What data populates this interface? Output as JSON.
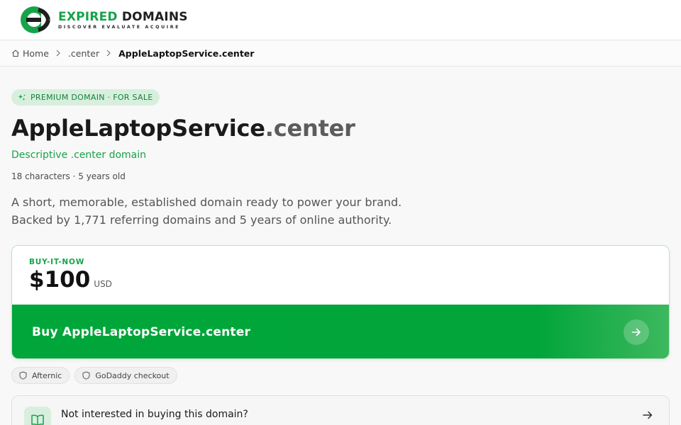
{
  "brand": {
    "title_green": "EXPIRED",
    "title_dark": "DOMAINS",
    "tagline": "DISCOVER EVALUATE ACQUIRE",
    "accent": "#16a34a"
  },
  "breadcrumb": {
    "home": "Home",
    "tld": ".center",
    "current": "AppleLaptopService.center"
  },
  "badge": "PREMIUM DOMAIN · FOR SALE",
  "domain": {
    "name": "AppleLaptopService",
    "tld": ".center",
    "subtitle": "Descriptive .center domain",
    "meta": "18 characters · 5 years old",
    "description_line1": "A short, memorable, established domain ready to power your brand.",
    "description_line2": "Backed by 1,771 referring domains and 5 years of online authority."
  },
  "pricing": {
    "label": "BUY-IT-NOW",
    "amount": "$100",
    "currency": "USD",
    "buy_label": "Buy AppleLaptopService.center"
  },
  "checkout_chips": [
    "Afternic",
    "GoDaddy checkout"
  ],
  "alternative": {
    "text": "Not interested in buying this domain?"
  },
  "icons": [
    "logo-mark",
    "home-icon",
    "chevron-right-icon",
    "sparkle-icon",
    "arrow-right-icon",
    "shield-icon",
    "book-icon"
  ]
}
